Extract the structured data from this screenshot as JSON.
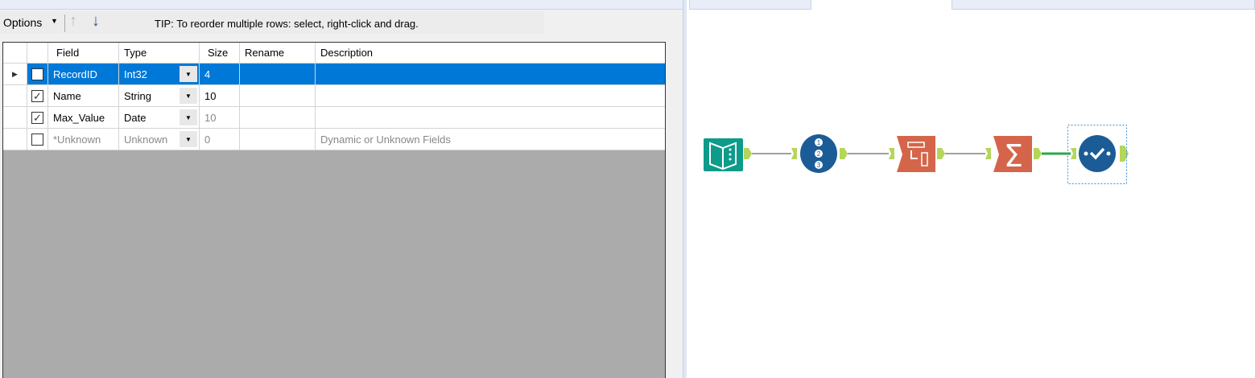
{
  "toolbar": {
    "options_label": "Options",
    "tip": "TIP: To reorder multiple rows: select, right-click and drag."
  },
  "grid": {
    "headers": {
      "field": "Field",
      "type": "Type",
      "size": "Size",
      "rename": "Rename",
      "description": "Description"
    },
    "rows": [
      {
        "checked": false,
        "field": "RecordID",
        "type": "Int32",
        "size": "4",
        "rename": "",
        "description": "",
        "selected": true
      },
      {
        "checked": true,
        "field": "Name",
        "type": "String",
        "size": "10",
        "rename": "",
        "description": ""
      },
      {
        "checked": true,
        "field": "Max_Value",
        "type": "Date",
        "size": "10",
        "rename": "",
        "description": ""
      },
      {
        "checked": false,
        "field": "*Unknown",
        "type": "Unknown",
        "size": "0",
        "rename": "",
        "description": "Dynamic or Unknown Fields"
      }
    ]
  },
  "workflow": {
    "tools": [
      "input-data-tool",
      "record-id-tool",
      "select-tool",
      "summarize-tool",
      "browse-tool"
    ],
    "colors": {
      "teal": "#0d9b8a",
      "blue": "#1b5c97",
      "orange": "#d5654a",
      "anchor": "#b5d65a",
      "connector_selected": "#2aa84a"
    }
  }
}
